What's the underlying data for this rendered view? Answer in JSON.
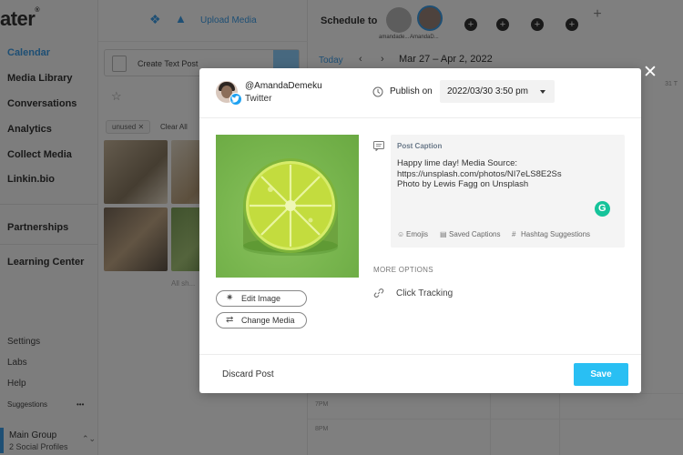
{
  "app": {
    "logo_text": "ater",
    "logo_mark": "®"
  },
  "sidebar": {
    "items": [
      {
        "label": "Calendar",
        "active": true
      },
      {
        "label": "Media Library"
      },
      {
        "label": "Conversations"
      },
      {
        "label": "Analytics"
      },
      {
        "label": "Collect Media"
      },
      {
        "label": "Linkin.bio"
      },
      {
        "label": "Partnerships"
      },
      {
        "label": "Learning Center"
      }
    ],
    "bottom_items": [
      {
        "label": "Settings"
      },
      {
        "label": "Labs"
      },
      {
        "label": "Help"
      },
      {
        "label": "Suggestions"
      }
    ],
    "suggestions_menu": "•••",
    "group": {
      "name": "Main Group",
      "sub": "2 Social Profiles"
    }
  },
  "media_panel": {
    "upload_label": "Upload Media",
    "create_text_post": "Create Text Post",
    "filter_chip": "unused ✕",
    "clear_all": "Clear All",
    "all_shown": "All sh..."
  },
  "calendar": {
    "schedule_to": "Schedule to",
    "profile_labels": [
      "amandade...",
      "AmandaD..."
    ],
    "today": "Today",
    "prev": "‹",
    "next": "›",
    "date_range": "Mar 27 – Apr 2, 2022",
    "corner_label": "31 T",
    "times": [
      "7PM",
      "8PM"
    ]
  },
  "overlay": {
    "close": "✕"
  },
  "modal": {
    "profile": {
      "handle": "@AmandaDemeku",
      "network": "Twitter"
    },
    "publish_on_label": "Publish on",
    "publish_datetime": "2022/03/30 3:50 pm",
    "edit_image": "Edit Image",
    "change_media": "Change Media",
    "caption": {
      "title": "Post Caption",
      "lines": [
        "Happy lime day! Media Source:",
        "https://unsplash.com/photos/NI7eLS8E2Ss",
        "Photo by Lewis Fagg on Unsplash"
      ],
      "grammarly": "G",
      "tools": {
        "emojis": "Emojis",
        "saved_captions": "Saved Captions",
        "hashtag_suggestions": "Hashtag Suggestions"
      }
    },
    "more_options": "MORE OPTIONS",
    "click_tracking": "Click Tracking",
    "discard": "Discard Post",
    "save": "Save"
  },
  "colors": {
    "accent": "#29bff3",
    "link_blue": "#3d9ee9",
    "twitter": "#1da1f2",
    "grammarly": "#15c39a",
    "overlay": "rgba(0,0,0,0.5)"
  },
  "icons": {
    "close": "close-icon",
    "clock": "clock-icon",
    "caption": "caption-icon",
    "link": "link-icon",
    "edit": "edit-image-icon",
    "change": "swap-icon",
    "emoji": "emoji-icon",
    "saved": "saved-captions-icon",
    "hashtag": "hashtag-icon",
    "twitter": "twitter-icon",
    "dropbox": "dropbox-icon",
    "drive": "google-drive-icon"
  }
}
